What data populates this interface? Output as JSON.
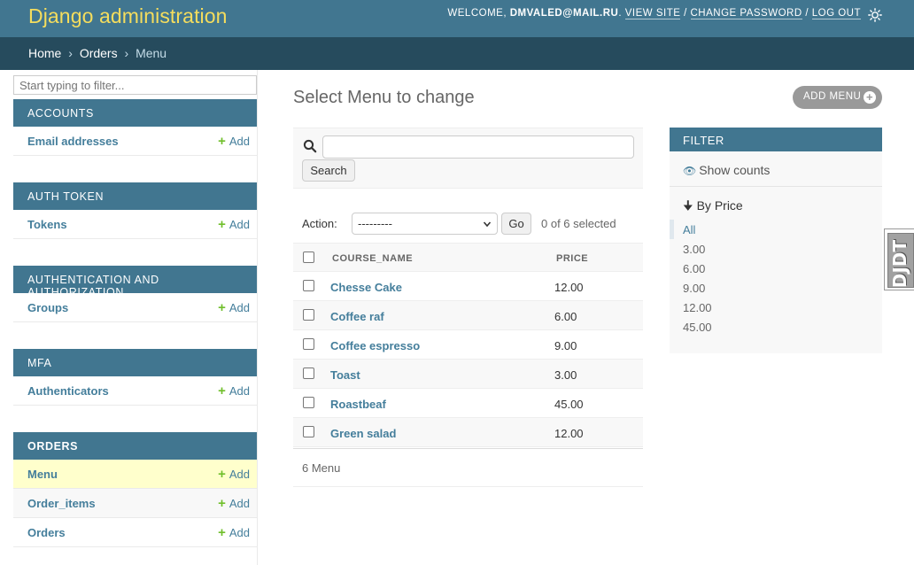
{
  "header": {
    "branding": "Django administration",
    "welcome_prefix": "WELCOME, ",
    "username": "DMVALED@MAIL.RU",
    "welcome_suffix": ". ",
    "view_site": "VIEW SITE",
    "sep1": " / ",
    "change_password": "CHANGE PASSWORD",
    "sep2": " / ",
    "log_out": "LOG OUT",
    "theme_icon": "sun-icon"
  },
  "breadcrumbs": {
    "home": "Home",
    "sep1": "›",
    "app": "Orders",
    "sep2": "›",
    "current": "Menu"
  },
  "sidebar": {
    "filter_placeholder": "Start typing to filter...",
    "add_label": "Add",
    "modules": [
      {
        "caption": "ACCOUNTS",
        "models": [
          {
            "name": "Email addresses"
          }
        ]
      },
      {
        "caption": "AUTH TOKEN",
        "models": [
          {
            "name": "Tokens"
          }
        ]
      },
      {
        "caption": "AUTHENTICATION AND AUTHORIZATION",
        "models": [
          {
            "name": "Groups"
          }
        ]
      },
      {
        "caption": "MFA",
        "models": [
          {
            "name": "Authenticators"
          }
        ]
      },
      {
        "caption": "ORDERS",
        "models": [
          {
            "name": "Menu"
          },
          {
            "name": "Order_items"
          },
          {
            "name": "Orders"
          }
        ]
      }
    ]
  },
  "content": {
    "title": "Select Menu to change",
    "add_button": "ADD MENU",
    "search": {
      "value": "",
      "button": "Search"
    },
    "actions": {
      "label": "Action:",
      "selected_option": "---------",
      "go": "Go",
      "counter": "0 of 6 selected"
    },
    "table": {
      "columns": [
        "COURSE_NAME",
        "PRICE"
      ],
      "rows": [
        {
          "course_name": "Chesse Cake",
          "price": "12.00"
        },
        {
          "course_name": "Coffee raf",
          "price": "6.00"
        },
        {
          "course_name": "Coffee espresso",
          "price": "9.00"
        },
        {
          "course_name": "Toast",
          "price": "3.00"
        },
        {
          "course_name": "Roastbeaf",
          "price": "45.00"
        },
        {
          "course_name": "Green salad",
          "price": "12.00"
        }
      ]
    },
    "paginator": "6 Menu"
  },
  "filter": {
    "header": "FILTER",
    "show_counts": "Show counts",
    "by_price": "By Price",
    "options": [
      "All",
      "3.00",
      "6.00",
      "9.00",
      "12.00",
      "45.00"
    ],
    "selected": "All"
  },
  "debug_toolbar": {
    "label": "DJDT"
  },
  "colors": {
    "header_bg": "#417690",
    "branding": "#f5dd5d",
    "breadcrumbs_bg": "#264b5d",
    "link": "#447e9b",
    "add_plus": "#70bf2b",
    "current_row": "#ffffcc"
  }
}
